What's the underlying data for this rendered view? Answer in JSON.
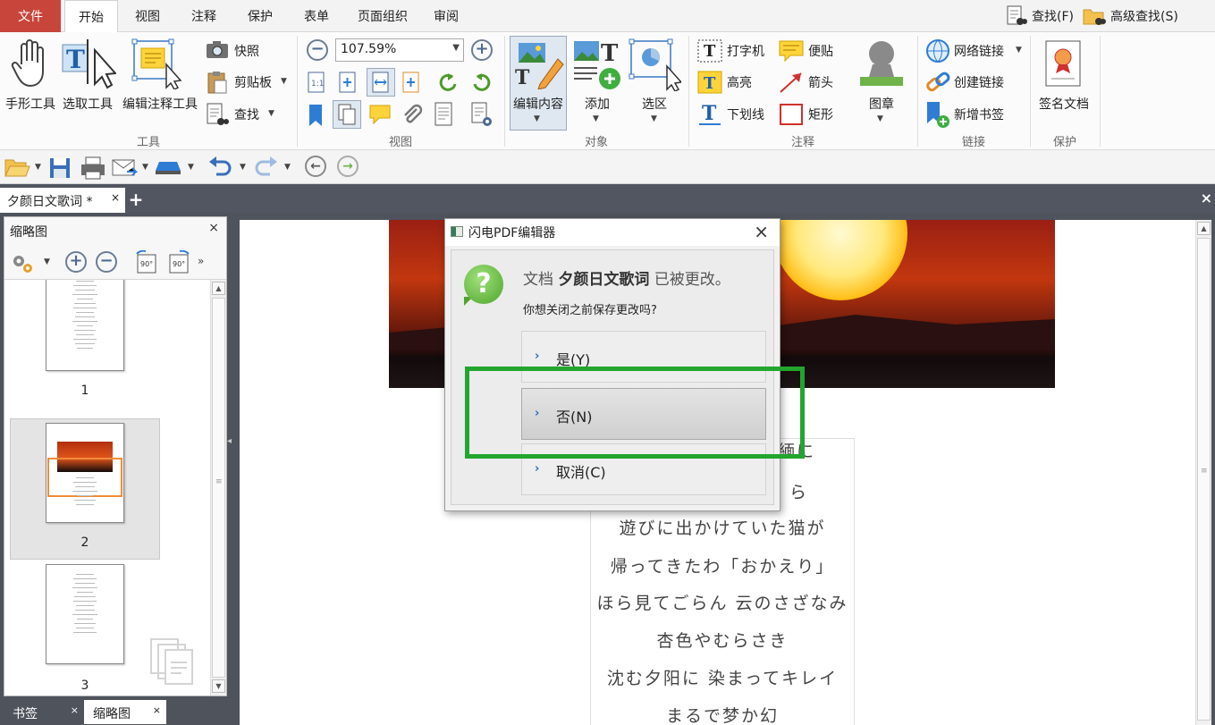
{
  "menubar": {
    "file": "文件",
    "tabs": [
      "开始",
      "视图",
      "注释",
      "保护",
      "表单",
      "页面组织",
      "审阅"
    ],
    "find": "查找(F)",
    "advanced_find": "高级查找(S)"
  },
  "ribbon": {
    "tools": {
      "hand": "手形工具",
      "select": "选取工具",
      "edit_annot": "编辑注释工具",
      "snapshot": "快照",
      "clipboard": "剪贴板",
      "find": "查找",
      "label": "工具"
    },
    "view": {
      "zoom": "107.59%",
      "label": "视图"
    },
    "object": {
      "edit_content": "编辑内容",
      "add": "添加",
      "select_area": "选区",
      "label": "对象"
    },
    "annot": {
      "typewriter": "打字机",
      "highlight": "高亮",
      "underline": "下划线",
      "note": "便贴",
      "arrow": "箭头",
      "rect": "矩形",
      "stamp": "图章",
      "label": "注释"
    },
    "link": {
      "web_link": "网络链接",
      "create_link": "创建链接",
      "new_bookmark": "新增书签",
      "label": "链接"
    },
    "protect": {
      "sign": "签名文档",
      "label": "保护"
    }
  },
  "doc_tab": {
    "title": "夕颜日文歌词 *"
  },
  "left_panel": {
    "title": "缩略图",
    "pages": [
      "1",
      "2",
      "3"
    ],
    "bottom_tabs": [
      "书签",
      "缩略图"
    ]
  },
  "document": {
    "lyrics": [
      "遊びに出かけていた猫が",
      "帰ってきたわ「おかえり」",
      "ほら見てごらん 云のさざなみ",
      "杏色やむらさき",
      "沈む夕阳に 染まってキレイ",
      "まるで梦か幻"
    ],
    "partial_lines": [
      "緬に",
      "ら"
    ]
  },
  "dialog": {
    "title": "闪电PDF编辑器",
    "msg_prefix": "文档 ",
    "doc_name": "夕颜日文歌词",
    "msg_suffix": " 已被更改。",
    "question": "你想关闭之前保存更改吗?",
    "yes": "是(Y)",
    "no": "否(N)",
    "cancel": "取消(C)"
  },
  "colors": {
    "file_tab": "#c8453b",
    "highlight": "#22a62e",
    "question_icon": "#4ea52d"
  }
}
